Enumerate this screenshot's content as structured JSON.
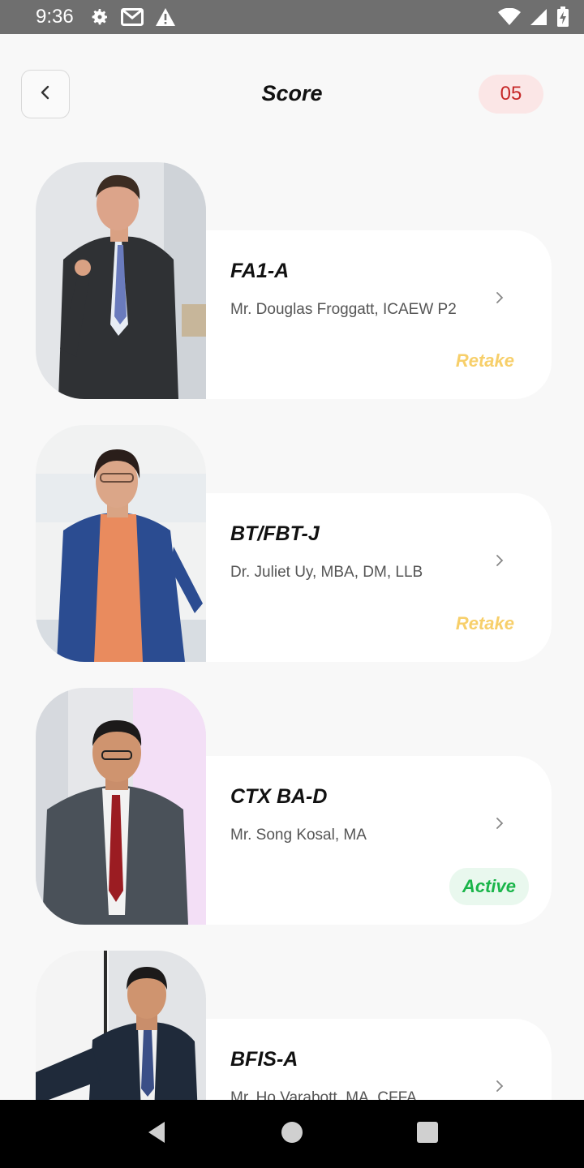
{
  "status_bar": {
    "time": "9:36"
  },
  "header": {
    "title": "Score",
    "score": "05"
  },
  "courses": [
    {
      "code": "FA1-A",
      "instructor": "Mr. Douglas Froggatt, ICAEW P2",
      "status": "Retake"
    },
    {
      "code": "BT/FBT-J",
      "instructor": "Dr. Juliet Uy, MBA, DM, LLB",
      "status": "Retake"
    },
    {
      "code": "CTX BA-D",
      "instructor": "Mr. Song Kosal, MA",
      "status": "Active"
    },
    {
      "code": "BFIS-A",
      "instructor": "Mr. Ho Varabott, MA, CFFA",
      "status": ""
    }
  ],
  "colors": {
    "retake": "#f7cf6a",
    "active": "#1ab54a",
    "score_badge": "#c62828"
  }
}
